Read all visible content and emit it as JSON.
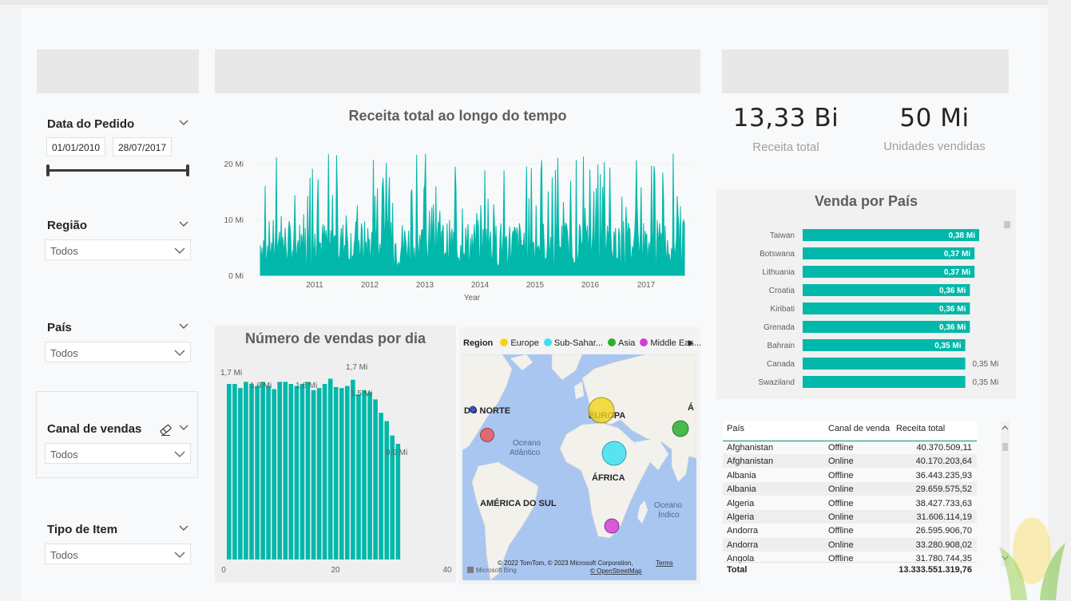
{
  "slicers": {
    "data_pedido": {
      "title": "Data do Pedido",
      "start": "01/01/2010",
      "end": "28/07/2017"
    },
    "regiao": {
      "title": "Região",
      "value": "Todos"
    },
    "pais": {
      "title": "País",
      "value": "Todos"
    },
    "canal": {
      "title": "Canal de vendas",
      "value": "Todos"
    },
    "tipo_item": {
      "title": "Tipo de Item",
      "value": "Todos"
    }
  },
  "kpis": {
    "receita": {
      "value": "13,33 Bi",
      "label": "Receita total"
    },
    "unidades": {
      "value": "50 Mi",
      "label": "Unidades vendidas"
    }
  },
  "line_chart": {
    "title": "Receita total ao longo do tempo",
    "xlabel": "Year",
    "y_ticks": [
      "20 Mi",
      "10 Mi",
      "0 Mi"
    ],
    "x_ticks": [
      "2011",
      "2012",
      "2013",
      "2014",
      "2015",
      "2016",
      "2017"
    ],
    "color": "#01b8aa"
  },
  "daily_chart": {
    "title": "Número de vendas por dia",
    "x_ticks": [
      "0",
      "20",
      "40"
    ],
    "data_labels": [
      "1,7 Mi",
      "1,6 Mi",
      "1,6 Mi",
      "1,7 Mi",
      "1,5 Mi",
      "0,9 Mi"
    ],
    "color": "#01b8aa"
  },
  "map": {
    "legend_title": "Region",
    "legend": [
      {
        "name": "Europe",
        "color": "#f2d51a"
      },
      {
        "name": "Sub-Sahar...",
        "color": "#3ee0f2"
      },
      {
        "name": "Asia",
        "color": "#2bb02b"
      },
      {
        "name": "Middle Eas...",
        "color": "#d23fd4"
      }
    ],
    "labels": {
      "north_america": "DO NORTE",
      "europe": "EUROPA",
      "africa": "ÁFRICA",
      "south_america": "AMÉRICA DO SUL",
      "atlantic": "Oceano\nAtlântico",
      "indian": "Oceano\nÍndico",
      "asia_edge": "Á"
    },
    "credits": "© 2022 TomTom, © 2023 Microsoft Corporation,",
    "terms": "Terms",
    "osm": "© OpenStreetMap",
    "bing": "Microsoft Bing",
    "extra_colors": {
      "north_america_blue": "#2a4fc9",
      "north_america_red": "#e8595d"
    }
  },
  "country_chart": {
    "title": "Venda por País",
    "bars": [
      {
        "country": "Taiwan",
        "label": "0,38 Mi",
        "value": 0.38
      },
      {
        "country": "Botswana",
        "label": "0,37 Mi",
        "value": 0.37
      },
      {
        "country": "Lithuania",
        "label": "0,37 Mi",
        "value": 0.37
      },
      {
        "country": "Croatia",
        "label": "0,36 Mi",
        "value": 0.36
      },
      {
        "country": "Kiribati",
        "label": "0,36 Mi",
        "value": 0.36
      },
      {
        "country": "Grenada",
        "label": "0,36 Mi",
        "value": 0.36
      },
      {
        "country": "Bahrain",
        "label": "0,35 Mi",
        "value": 0.35
      },
      {
        "country": "Canada",
        "label": "0,35 Mi",
        "value": 0.35
      },
      {
        "country": "Swaziland",
        "label": "0,35 Mi",
        "value": 0.35
      }
    ],
    "color": "#01b8aa"
  },
  "table": {
    "headers": [
      "País",
      "Canal de venda",
      "Receita total"
    ],
    "rows": [
      [
        "Afghanistan",
        "Offline",
        "40.370.509,11"
      ],
      [
        "Afghanistan",
        "Online",
        "40.170.203,64"
      ],
      [
        "Albania",
        "Offline",
        "36.443.235,93"
      ],
      [
        "Albania",
        "Online",
        "29.659.575,52"
      ],
      [
        "Algeria",
        "Offline",
        "38.427.733,63"
      ],
      [
        "Algeria",
        "Online",
        "31.606.114,19"
      ],
      [
        "Andorra",
        "Offline",
        "26.595.906,70"
      ],
      [
        "Andorra",
        "Online",
        "33.280.908,02"
      ],
      [
        "Angola",
        "Offline",
        "31.780.744,35"
      ]
    ],
    "total_label": "Total",
    "total_value": "13.333.551.319,76"
  }
}
